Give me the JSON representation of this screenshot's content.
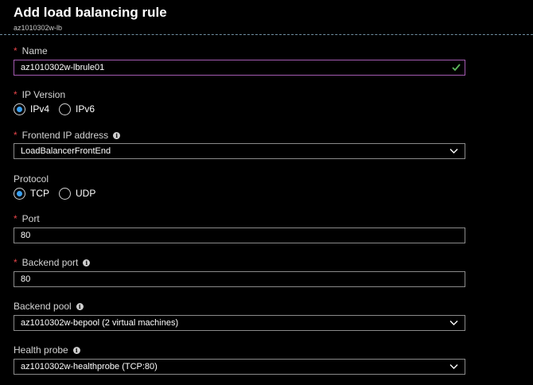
{
  "header": {
    "title": "Add load balancing rule",
    "subtitle": "az1010302w-lb"
  },
  "form": {
    "name": {
      "label": "Name",
      "required": true,
      "value": "az1010302w-lbrule01"
    },
    "ip_version": {
      "label": "IP Version",
      "required": true,
      "options": [
        "IPv4",
        "IPv6"
      ],
      "selected": "IPv4"
    },
    "frontend_ip": {
      "label": "Frontend IP address",
      "required": true,
      "value": "LoadBalancerFrontEnd"
    },
    "protocol": {
      "label": "Protocol",
      "options": [
        "TCP",
        "UDP"
      ],
      "selected": "TCP"
    },
    "port": {
      "label": "Port",
      "required": true,
      "value": "80"
    },
    "backend_port": {
      "label": "Backend port",
      "required": true,
      "value": "80"
    },
    "backend_pool": {
      "label": "Backend pool",
      "value": "az1010302w-bepool (2 virtual machines)"
    },
    "health_probe": {
      "label": "Health probe",
      "value": "az1010302w-healthprobe (TCP:80)"
    }
  },
  "icons": {
    "required_marker": "*",
    "info": "info-icon",
    "valid": "checkmark-icon",
    "dropdown": "chevron-down-icon"
  },
  "colors": {
    "background": "#000000",
    "required": "#e8454a",
    "radio_selected": "#3aa0f0",
    "valid_check": "#5cb85c",
    "active_border": "#a35ab0"
  }
}
